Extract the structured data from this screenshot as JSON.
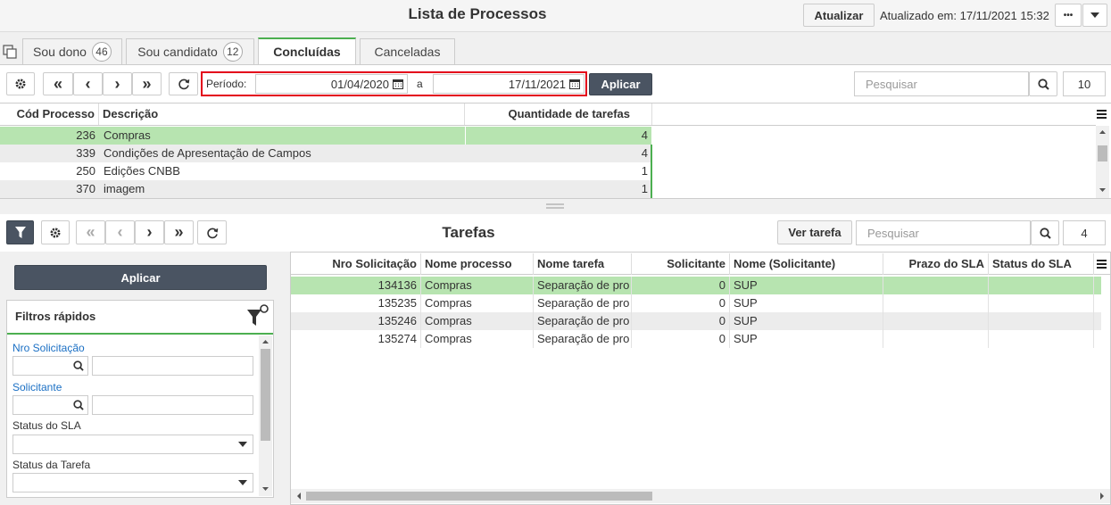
{
  "header": {
    "title": "Lista de Processos",
    "refresh_label": "Atualizar",
    "updated_text": "Atualizado em: 17/11/2021 15:32",
    "more_label": "•••"
  },
  "tabs": [
    {
      "label": "Sou dono",
      "count": "46"
    },
    {
      "label": "Sou candidato",
      "count": "12"
    },
    {
      "label": "Concluídas"
    },
    {
      "label": "Canceladas"
    }
  ],
  "toolbar": {
    "period_label": "Período:",
    "date_from": "01/04/2020",
    "date_sep": "a",
    "date_to": "17/11/2021",
    "apply_label": "Aplicar",
    "search_placeholder": "Pesquisar",
    "page_size": "10"
  },
  "process_table": {
    "columns": [
      "Cód Processo",
      "Descrição",
      "Quantidade de tarefas"
    ],
    "rows": [
      {
        "code": "236",
        "desc": "Compras",
        "qty": "4"
      },
      {
        "code": "339",
        "desc": "Condições de Apresentação de Campos",
        "qty": "4"
      },
      {
        "code": "250",
        "desc": "Edições CNBB",
        "qty": "1"
      },
      {
        "code": "370",
        "desc": "imagem",
        "qty": "1"
      }
    ]
  },
  "tasks": {
    "title": "Tarefas",
    "view_task_label": "Ver tarefa",
    "search_placeholder": "Pesquisar",
    "page_size": "4",
    "apply_label": "Aplicar",
    "quick_filters_title": "Filtros rápidos",
    "filters": {
      "nro_label": "Nro Solicitação",
      "requester_label": "Solicitante",
      "sla_label": "Status do SLA",
      "task_status_label": "Status da Tarefa"
    },
    "columns": [
      "Nro Solicitação",
      "Nome processo",
      "Nome tarefa",
      "Solicitante",
      "Nome (Solicitante)",
      "Prazo do SLA",
      "Status do SLA"
    ],
    "rows": [
      {
        "nro": "134136",
        "proc": "Compras",
        "task": "Separação de pro",
        "req": "0",
        "name": "SUP"
      },
      {
        "nro": "135235",
        "proc": "Compras",
        "task": "Separação de pro",
        "req": "0",
        "name": "SUP"
      },
      {
        "nro": "135246",
        "proc": "Compras",
        "task": "Separação de pro",
        "req": "0",
        "name": "SUP"
      },
      {
        "nro": "135274",
        "proc": "Compras",
        "task": "Separação de pro",
        "req": "0",
        "name": "SUP"
      }
    ]
  },
  "colors": {
    "selected_row": "#b7e4b0",
    "accent_green": "#4caf50",
    "highlight_red": "#e3001b",
    "dark_button": "#4a5462",
    "link_blue": "#1a6fc4"
  }
}
